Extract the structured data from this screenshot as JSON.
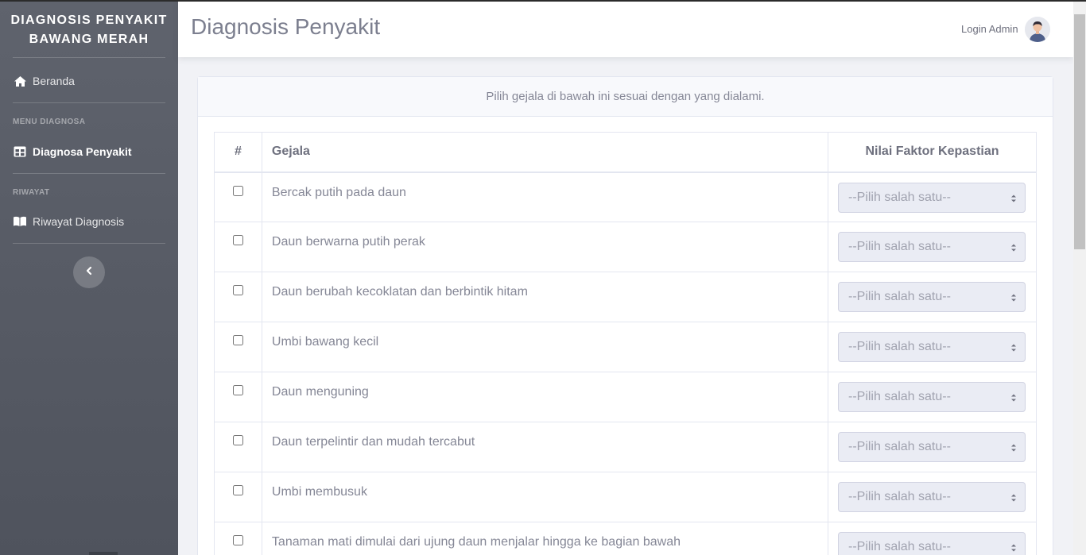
{
  "sidebar": {
    "brand_line1": "DIAGNOSIS PENYAKIT",
    "brand_line2": "BAWANG MERAH",
    "home_label": "Beranda",
    "section_diagnosa": "MENU DIAGNOSA",
    "diagnosa_label": "Diagnosa Penyakit",
    "section_riwayat": "RIWAYAT",
    "riwayat_label": "Riwayat Diagnosis"
  },
  "topbar": {
    "title": "Diagnosis Penyakit",
    "login_label": "Login Admin"
  },
  "card": {
    "instruction": "Pilih gejala di bawah ini sesuai dengan yang dialami."
  },
  "table": {
    "headers": {
      "num": "#",
      "gejala": "Gejala",
      "nilai": "Nilai Faktor Kepastian"
    },
    "select_placeholder": "--Pilih salah satu--",
    "rows": [
      {
        "gejala": "Bercak putih pada daun",
        "checked": false
      },
      {
        "gejala": "Daun berwarna putih perak",
        "checked": false
      },
      {
        "gejala": "Daun berubah kecoklatan dan berbintik hitam",
        "checked": false
      },
      {
        "gejala": "Umbi bawang kecil",
        "checked": false
      },
      {
        "gejala": "Daun menguning",
        "checked": false
      },
      {
        "gejala": "Daun terpelintir dan mudah tercabut",
        "checked": false
      },
      {
        "gejala": "Umbi membusuk",
        "checked": false
      },
      {
        "gejala": "Tanaman mati dimulai dari ujung daun menjalar hingga ke bagian bawah",
        "checked": false
      }
    ]
  },
  "colors": {
    "sidebar_top": "#5f636d",
    "sidebar_bottom": "#4f535d",
    "text_muted": "#858796",
    "border": "#e3e6f0"
  },
  "icons": {
    "home": "home-icon",
    "diagnosa": "table-icon",
    "riwayat": "book-icon",
    "toggle": "chevron-left-icon",
    "avatar": "user-avatar",
    "select_caret": "sort-caret-icon"
  }
}
